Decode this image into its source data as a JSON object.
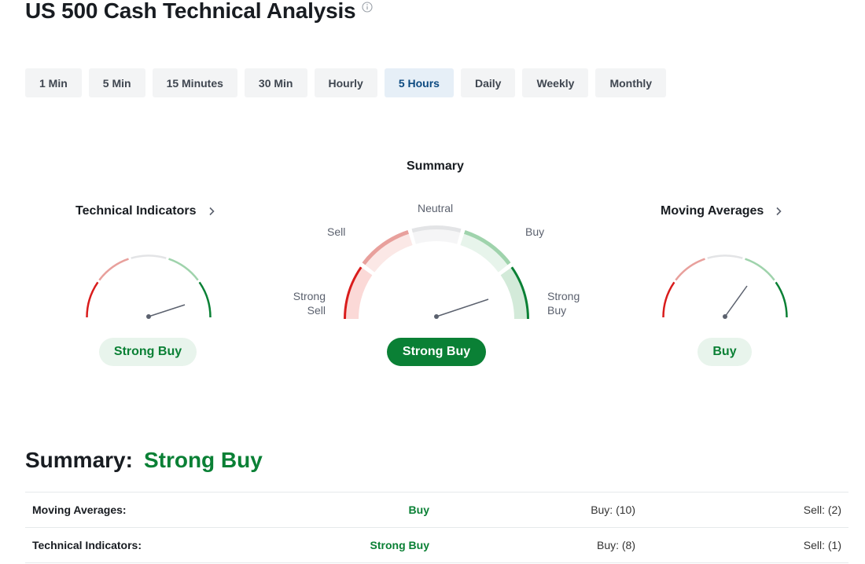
{
  "page": {
    "title": "US 500 Cash Technical Analysis"
  },
  "timeframes": {
    "items": [
      "1 Min",
      "5 Min",
      "15 Minutes",
      "30 Min",
      "Hourly",
      "5 Hours",
      "Daily",
      "Weekly",
      "Monthly"
    ],
    "active": "5 Hours"
  },
  "gauges": {
    "summary": {
      "title": "Summary",
      "result": "Strong Buy",
      "labels": {
        "strong_sell": [
          "Strong",
          "Sell"
        ],
        "sell": "Sell",
        "neutral": "Neutral",
        "buy": "Buy",
        "strong_buy": [
          "Strong",
          "Buy"
        ]
      }
    },
    "technical": {
      "title": "Technical Indicators",
      "result": "Strong Buy"
    },
    "moving": {
      "title": "Moving Averages",
      "result": "Buy"
    }
  },
  "summary": {
    "label": "Summary:",
    "value": "Strong Buy",
    "rows": [
      {
        "label": "Moving Averages:",
        "value": "Buy",
        "buy": "Buy: (10)",
        "sell": "Sell: (2)"
      },
      {
        "label": "Technical Indicators:",
        "value": "Strong Buy",
        "buy": "Buy: (8)",
        "sell": "Sell: (1)"
      }
    ]
  },
  "colors": {
    "strong_sell": "#d91c1c",
    "sell": "#e8a09c",
    "neutral": "#e3e4e6",
    "buy": "#9fd3ac",
    "strong_buy": "#0a8035",
    "active_tab_bg": "#e6eff7",
    "active_tab_text": "#0c4a80"
  }
}
